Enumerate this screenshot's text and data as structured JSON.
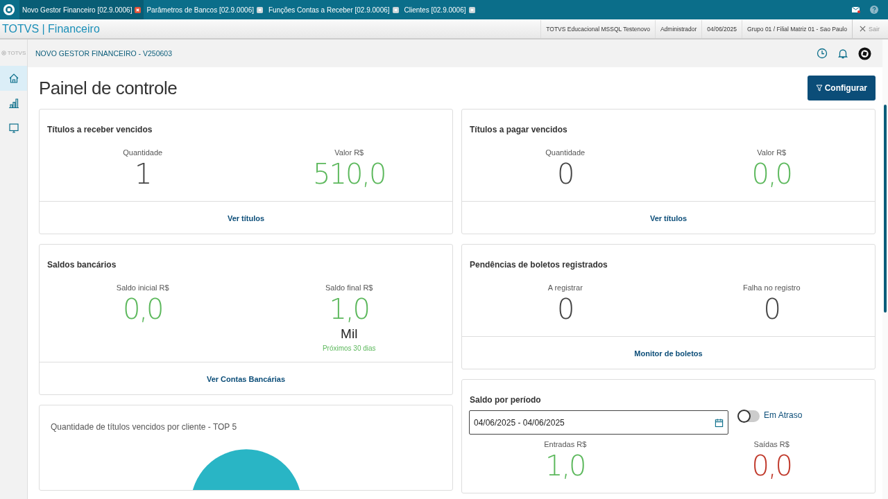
{
  "tabs": [
    {
      "label": "Novo Gestor Financeiro [02.9.0006]",
      "selected": true
    },
    {
      "label": "Parâmetros de Bancos [02.9.0006]",
      "selected": false
    },
    {
      "label": "Funções Contas a Receber [02.9.0006]",
      "selected": false
    },
    {
      "label": "Clientes [02.9.0006]",
      "selected": false
    }
  ],
  "app_bar": {
    "title": "TOTVS | Financeiro",
    "info": [
      "TOTVS Educacional MSSQL Testenovo",
      "Administrador",
      "04/06/2025",
      "Grupo 01 / Filial Matriz 01 - Sao Paulo"
    ],
    "exit": "Sair"
  },
  "sidebar": {
    "logo": "TOTVS",
    "items": [
      {
        "kind": "home",
        "selected": true
      },
      {
        "kind": "chart",
        "selected": false
      },
      {
        "kind": "monitor",
        "selected": false
      }
    ]
  },
  "header": {
    "title": "NOVO GESTOR FINANCEIRO - V250603"
  },
  "page": {
    "title": "Painel de controle",
    "button": "Configurar"
  },
  "left_cards": [
    {
      "title": "Títulos a receber vencidos",
      "metrics": [
        {
          "label": "Quantidade",
          "value": "1",
          "color": "#444444"
        },
        {
          "label": "Valor R$",
          "value": "510,0",
          "color": "#5cb85c"
        }
      ],
      "link": "Ver títulos"
    },
    {
      "title": "Saldos bancários",
      "metrics": [
        {
          "label": "Saldo inicial R$",
          "value": "0,0",
          "color": "#5cb85c"
        },
        {
          "label": "Saldo final R$",
          "value": "1,0",
          "color": "#5cb85c",
          "unit": "Mil",
          "note": "Próximos 30 dias"
        }
      ],
      "link": "Ver Contas Bancárias"
    },
    {
      "title": "Quantidade de títulos vencidos por cliente - TOP 5"
    }
  ],
  "right_cards": [
    {
      "title": "Títulos a pagar vencidos",
      "metrics": [
        {
          "label": "Quantidade",
          "value": "0",
          "color": "#444444"
        },
        {
          "label": "Valor R$",
          "value": "0,0",
          "color": "#5cb85c"
        }
      ],
      "link": "Ver títulos"
    },
    {
      "title": "Pendências de boletos registrados",
      "metrics": [
        {
          "label": "A registrar",
          "value": "0",
          "color": "#444444"
        },
        {
          "label": "Falha no registro",
          "value": "0",
          "color": "#444444"
        }
      ],
      "link": "Monitor de boletos"
    },
    {
      "title": "Saldo por período",
      "period": {
        "value": "04/06/2025 - 04/06/2025"
      },
      "toggle": {
        "label": "Em Atraso",
        "on": false
      },
      "metrics": [
        {
          "label": "Entradas R$",
          "value": "1,0",
          "color": "#5cb85c"
        },
        {
          "label": "Saídas R$",
          "value": "0,0",
          "color": "#c0392b"
        }
      ]
    }
  ]
}
